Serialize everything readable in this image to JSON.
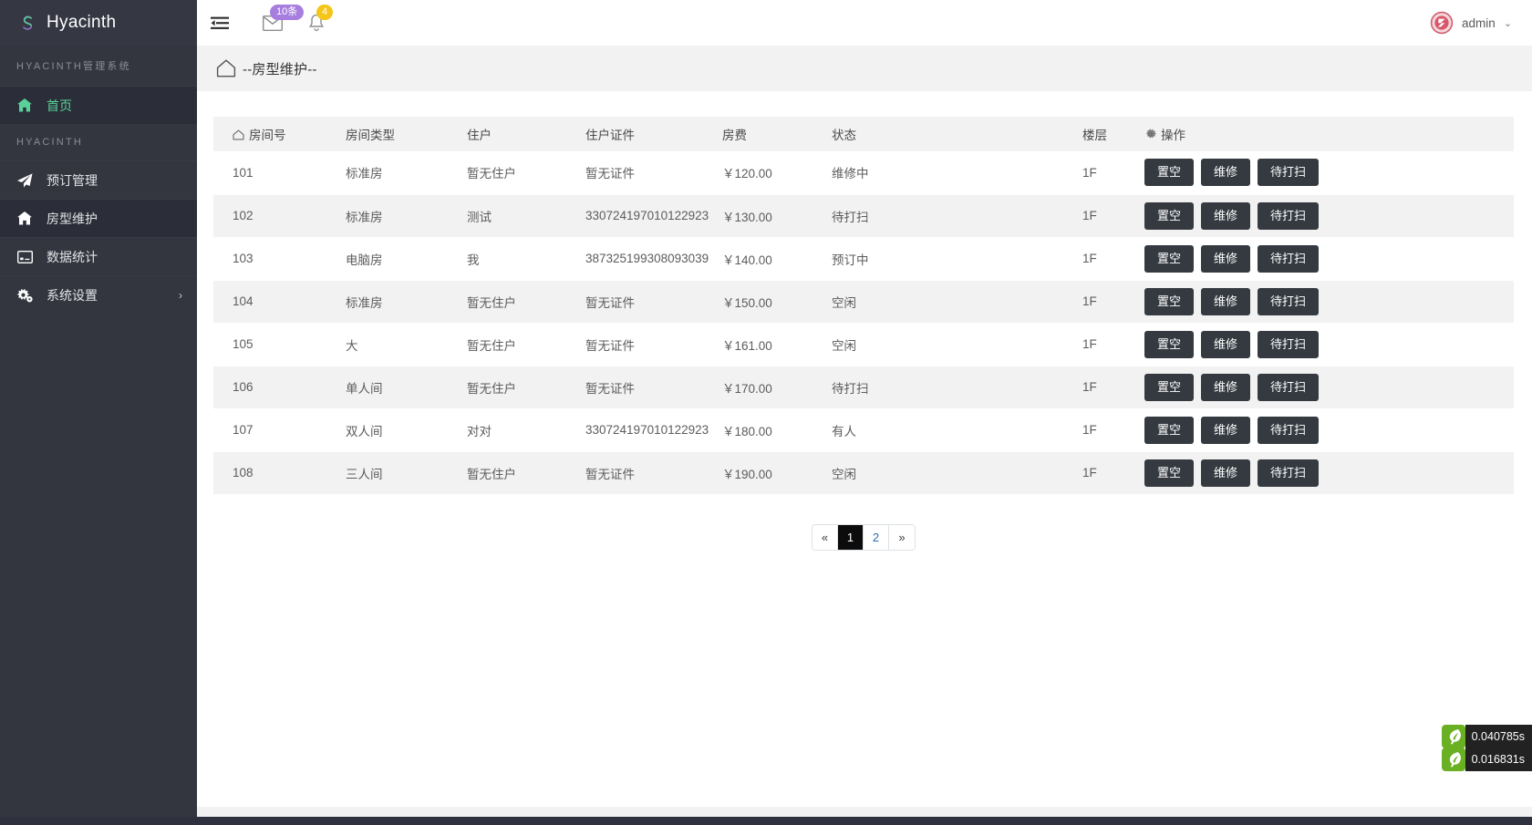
{
  "sidebar": {
    "brand": {
      "name": "Hyacinth",
      "logo_icon": "s-logo-icon"
    },
    "heading_top": "HYACINTH管理系统",
    "heading_mid": "HYACINTH",
    "items": [
      {
        "label": "首页",
        "icon": "home-icon",
        "state": "active"
      },
      {
        "label": "预订管理",
        "icon": "paper-plane-icon",
        "state": "normal"
      },
      {
        "label": "房型维护",
        "icon": "home-icon",
        "state": "current"
      },
      {
        "label": "数据统计",
        "icon": "chart-card-icon",
        "state": "normal"
      },
      {
        "label": "系统设置",
        "icon": "gears-icon",
        "state": "normal",
        "caret": "›"
      }
    ]
  },
  "topbar": {
    "menu_icon": "hamburger-collapse-icon",
    "mail": {
      "icon": "envelope-icon",
      "badge": "10条"
    },
    "bell": {
      "icon": "bell-icon",
      "badge": "4"
    },
    "user": {
      "name": "admin",
      "caret": "⌄",
      "avatar_icon": "seal-avatar-icon"
    }
  },
  "breadcrumb": {
    "icon": "home-outline-icon",
    "text": "--房型维护--"
  },
  "table": {
    "columns": [
      {
        "key": "room",
        "label": "房间号",
        "icon": "home-outline-icon"
      },
      {
        "key": "type",
        "label": "房间类型"
      },
      {
        "key": "guest",
        "label": "住户"
      },
      {
        "key": "idcard",
        "label": "住户证件"
      },
      {
        "key": "fee",
        "label": "房费"
      },
      {
        "key": "status",
        "label": "状态"
      },
      {
        "key": "floor",
        "label": "楼层"
      },
      {
        "key": "action",
        "label": "操作",
        "icon": "gear-icon"
      }
    ],
    "actions": [
      "置空",
      "维修",
      "待打扫"
    ],
    "rows": [
      {
        "room": "101",
        "type": "标准房",
        "guest": "暂无住户",
        "idcard": "暂无证件",
        "fee": "￥120.00",
        "status": "维修中",
        "floor": "1F"
      },
      {
        "room": "102",
        "type": "标准房",
        "guest": "测试",
        "idcard": "330724197010122923",
        "fee": "￥130.00",
        "status": "待打扫",
        "floor": "1F"
      },
      {
        "room": "103",
        "type": "电脑房",
        "guest": "我",
        "idcard": "387325199308093039",
        "fee": "￥140.00",
        "status": "预订中",
        "floor": "1F"
      },
      {
        "room": "104",
        "type": "标准房",
        "guest": "暂无住户",
        "idcard": "暂无证件",
        "fee": "￥150.00",
        "status": "空闲",
        "floor": "1F"
      },
      {
        "room": "105",
        "type": "大",
        "guest": "暂无住户",
        "idcard": "暂无证件",
        "fee": "￥161.00",
        "status": "空闲",
        "floor": "1F"
      },
      {
        "room": "106",
        "type": "单人间",
        "guest": "暂无住户",
        "idcard": "暂无证件",
        "fee": "￥170.00",
        "status": "待打扫",
        "floor": "1F"
      },
      {
        "room": "107",
        "type": "双人间",
        "guest": "对对",
        "idcard": "330724197010122923",
        "fee": "￥180.00",
        "status": "有人",
        "floor": "1F"
      },
      {
        "room": "108",
        "type": "三人间",
        "guest": "暂无住户",
        "idcard": "暂无证件",
        "fee": "￥190.00",
        "status": "空闲",
        "floor": "1F"
      }
    ]
  },
  "pagination": {
    "prev": "«",
    "next": "»",
    "pages": [
      {
        "label": "1",
        "active": true
      },
      {
        "label": "2",
        "active": false
      }
    ]
  },
  "timings": [
    {
      "value": "0.040785s",
      "icon": "leaf-icon"
    },
    {
      "value": "0.016831s",
      "icon": "leaf-icon"
    }
  ],
  "colors": {
    "sidebar_bg": "#2f323e",
    "sidebar_item_bg": "#33363f",
    "sidebar_active_bg": "#2b2e38",
    "accent_green": "#5ad19a",
    "button_dark": "#343a40",
    "badge_purple": "#a77ede",
    "badge_yellow": "#f5c518",
    "row_alt": "#f2f2f2",
    "link_blue": "#2f6fb5"
  }
}
